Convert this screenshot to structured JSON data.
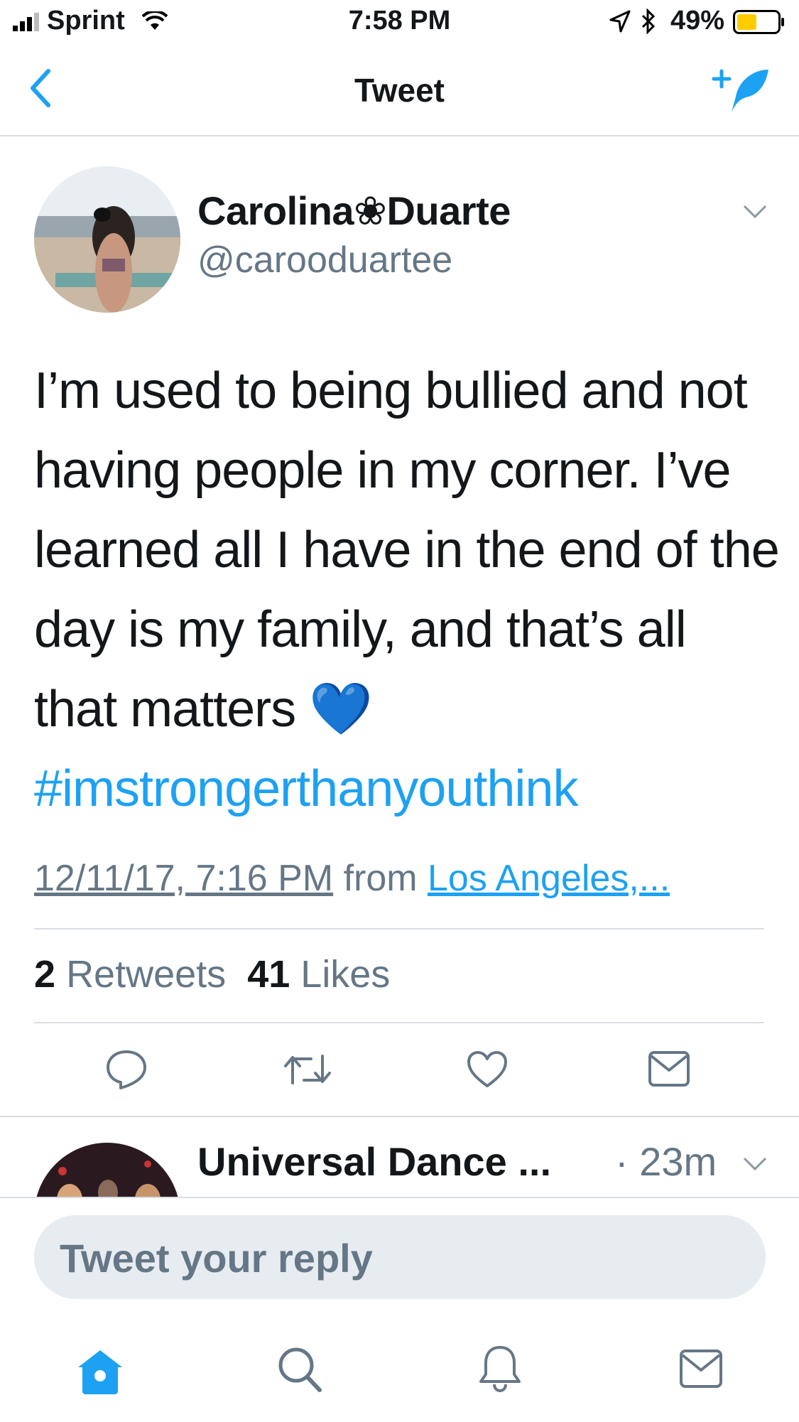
{
  "status_bar": {
    "carrier": "Sprint",
    "time": "7:58 PM",
    "battery": "49%",
    "battery_level": 0.49
  },
  "nav": {
    "title": "Tweet"
  },
  "tweet": {
    "name": "Carolina❀Duarte",
    "handle": "@carooduartee",
    "text": "I’m used to being bullied and not having people in my corner. I’ve learned all I have in the end of the day is my family, and that’s all that matters 💙",
    "hashtag": "#imstrongerthanyouthink",
    "timestamp": "12/11/17, 7:16 PM",
    "from_label": "from",
    "location": "Los Angeles,...",
    "retweets_count": "2",
    "retweets_label": "Retweets",
    "likes_count": "41",
    "likes_label": "Likes"
  },
  "next_tweet": {
    "name": "Universal Dance ...",
    "time": "· 23m"
  },
  "reply": {
    "placeholder": "Tweet your reply"
  },
  "tab_bar": {
    "items": [
      "home-icon",
      "search-icon",
      "notifications-icon",
      "messages-icon"
    ]
  },
  "colors": {
    "accent": "#1da1f2",
    "muted": "#657786",
    "battery": "#ffcc00"
  }
}
